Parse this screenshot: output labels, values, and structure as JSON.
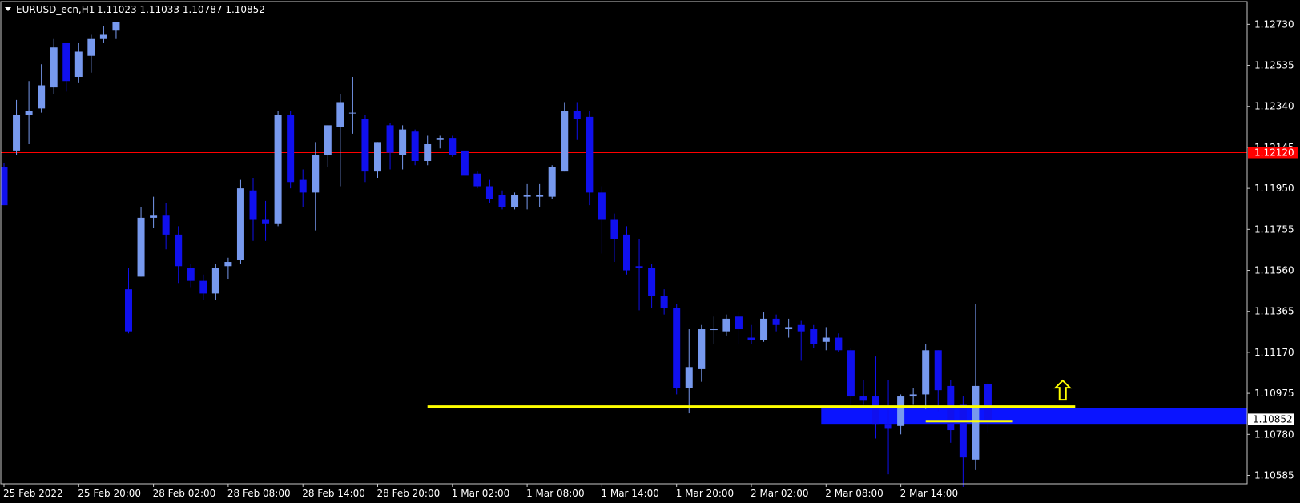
{
  "chart_data": {
    "type": "candlestick",
    "symbol_label": "EURUSD_ecn,H1",
    "ohlc_label": "1.11023 1.11033 1.10787 1.10852",
    "y_ticks": [
      "1.12730",
      "1.12535",
      "1.12340",
      "1.12145",
      "1.11950",
      "1.11755",
      "1.11560",
      "1.11365",
      "1.11170",
      "1.10975",
      "1.10780",
      "1.10585"
    ],
    "y_tick_values": [
      1.1273,
      1.12535,
      1.1234,
      1.12145,
      1.1195,
      1.11755,
      1.1156,
      1.11365,
      1.1117,
      1.10975,
      1.1078,
      1.10585
    ],
    "x_ticks": [
      "25 Feb 2022",
      "25 Feb 20:00",
      "28 Feb 02:00",
      "28 Feb 08:00",
      "28 Feb 14:00",
      "28 Feb 20:00",
      "1 Mar 02:00",
      "1 Mar 08:00",
      "1 Mar 14:00",
      "1 Mar 20:00",
      "2 Mar 02:00",
      "2 Mar 08:00",
      "2 Mar 14:00"
    ],
    "x_tick_bar_index": [
      0,
      6,
      12,
      18,
      24,
      30,
      36,
      42,
      48,
      54,
      60,
      66,
      72
    ],
    "ylim": [
      1.10545,
      1.12838
    ],
    "horizontal_line": {
      "price": 1.1212,
      "label": "1.12120",
      "color": "#ff0000"
    },
    "current_price": {
      "price": 1.10852,
      "label": "1.10852"
    },
    "zone": {
      "low": 1.1083,
      "high": 1.10905,
      "from_bar": 66,
      "color": "#0a14ff"
    },
    "yellow_lines": [
      {
        "price": 1.10912,
        "from_bar": 34,
        "to_bar": 86
      },
      {
        "price": 1.10843,
        "from_bar": 74,
        "to_bar": 81
      }
    ],
    "arrow": {
      "bar": 85,
      "price": 1.1099,
      "direction": "up",
      "color": "#ffff00"
    },
    "up_color": "#7799ee",
    "down_color": "#1010ee",
    "candles": [
      [
        1.1205,
        1.1207,
        1.1187,
        1.1187
      ],
      [
        1.1213,
        1.1237,
        1.1211,
        1.123
      ],
      [
        1.123,
        1.1246,
        1.1216,
        1.1232
      ],
      [
        1.1233,
        1.1254,
        1.1231,
        1.1244
      ],
      [
        1.1243,
        1.1266,
        1.124,
        1.1262
      ],
      [
        1.1264,
        1.1264,
        1.1241,
        1.1246
      ],
      [
        1.1248,
        1.1264,
        1.1245,
        1.126
      ],
      [
        1.1258,
        1.1268,
        1.125,
        1.1266
      ],
      [
        1.1266,
        1.1272,
        1.1264,
        1.1268
      ],
      [
        1.127,
        1.1274,
        1.1266,
        1.1274
      ],
      [
        1.1147,
        1.1157,
        1.1126,
        1.1127
      ],
      [
        1.1153,
        1.1186,
        1.1153,
        1.1181
      ],
      [
        1.1181,
        1.1191,
        1.1176,
        1.1182
      ],
      [
        1.1182,
        1.1188,
        1.1166,
        1.1173
      ],
      [
        1.1173,
        1.1177,
        1.115,
        1.1158
      ],
      [
        1.1157,
        1.1159,
        1.1148,
        1.1151
      ],
      [
        1.1151,
        1.1154,
        1.1142,
        1.1145
      ],
      [
        1.1145,
        1.1159,
        1.1142,
        1.1157
      ],
      [
        1.1158,
        1.1162,
        1.1152,
        1.116
      ],
      [
        1.1161,
        1.1199,
        1.1159,
        1.1195
      ],
      [
        1.1194,
        1.12,
        1.117,
        1.118
      ],
      [
        1.118,
        1.1189,
        1.117,
        1.1178
      ],
      [
        1.1178,
        1.1232,
        1.1177,
        1.123
      ],
      [
        1.123,
        1.1232,
        1.1195,
        1.1198
      ],
      [
        1.1199,
        1.1204,
        1.1186,
        1.1193
      ],
      [
        1.1193,
        1.1217,
        1.1175,
        1.1211
      ],
      [
        1.1211,
        1.1225,
        1.1205,
        1.1225
      ],
      [
        1.1224,
        1.124,
        1.1196,
        1.1236
      ],
      [
        1.1231,
        1.1248,
        1.1221,
        1.1231
      ],
      [
        1.1228,
        1.123,
        1.1198,
        1.1203
      ],
      [
        1.1203,
        1.1217,
        1.12,
        1.1217
      ],
      [
        1.1225,
        1.1226,
        1.1204,
        1.1212
      ],
      [
        1.1211,
        1.1225,
        1.1204,
        1.1223
      ],
      [
        1.1222,
        1.1223,
        1.1206,
        1.1208
      ],
      [
        1.1208,
        1.122,
        1.1206,
        1.1216
      ],
      [
        1.1218,
        1.122,
        1.1214,
        1.1219
      ],
      [
        1.1219,
        1.122,
        1.121,
        1.1211
      ],
      [
        1.1213,
        1.1213,
        1.1201,
        1.1201
      ],
      [
        1.1202,
        1.1203,
        1.1195,
        1.1196
      ],
      [
        1.1196,
        1.1199,
        1.1188,
        1.119
      ],
      [
        1.1192,
        1.1194,
        1.1185,
        1.1186
      ],
      [
        1.1186,
        1.1193,
        1.1185,
        1.1192
      ],
      [
        1.1191,
        1.1197,
        1.1185,
        1.1192
      ],
      [
        1.1191,
        1.1197,
        1.1186,
        1.1192
      ],
      [
        1.1191,
        1.1206,
        1.119,
        1.1205
      ],
      [
        1.1203,
        1.1236,
        1.1203,
        1.1232
      ],
      [
        1.1232,
        1.1236,
        1.1218,
        1.1228
      ],
      [
        1.1229,
        1.1232,
        1.1187,
        1.1193
      ],
      [
        1.1193,
        1.1196,
        1.1164,
        1.118
      ],
      [
        1.118,
        1.1183,
        1.116,
        1.1171
      ],
      [
        1.1173,
        1.1177,
        1.1154,
        1.1156
      ],
      [
        1.1158,
        1.1171,
        1.1137,
        1.1157
      ],
      [
        1.1157,
        1.1159,
        1.1138,
        1.1144
      ],
      [
        1.1144,
        1.1147,
        1.1135,
        1.1138
      ],
      [
        1.1138,
        1.114,
        1.1097,
        1.11
      ],
      [
        1.11,
        1.1128,
        1.1088,
        1.111
      ],
      [
        1.1109,
        1.113,
        1.1103,
        1.1128
      ],
      [
        1.1128,
        1.1134,
        1.1121,
        1.1128
      ],
      [
        1.1127,
        1.1135,
        1.1125,
        1.1133
      ],
      [
        1.1134,
        1.1136,
        1.1121,
        1.1128
      ],
      [
        1.1124,
        1.113,
        1.1121,
        1.1123
      ],
      [
        1.1123,
        1.1136,
        1.1122,
        1.1133
      ],
      [
        1.1133,
        1.1135,
        1.1127,
        1.113
      ],
      [
        1.1128,
        1.1133,
        1.1124,
        1.1129
      ],
      [
        1.113,
        1.1132,
        1.1113,
        1.1127
      ],
      [
        1.1128,
        1.113,
        1.1119,
        1.1121
      ],
      [
        1.1122,
        1.1129,
        1.1118,
        1.1124
      ],
      [
        1.1124,
        1.1126,
        1.1117,
        1.1118
      ],
      [
        1.1118,
        1.1119,
        1.1092,
        1.1096
      ],
      [
        1.1096,
        1.1104,
        1.1092,
        1.1094
      ],
      [
        1.1096,
        1.1115,
        1.1076,
        1.1083
      ],
      [
        1.1083,
        1.1104,
        1.1059,
        1.1081
      ],
      [
        1.1082,
        1.1097,
        1.1078,
        1.1096
      ],
      [
        1.1096,
        1.11,
        1.1092,
        1.1097
      ],
      [
        1.1097,
        1.1121,
        1.109,
        1.1118
      ],
      [
        1.1118,
        1.1118,
        1.1089,
        1.1099
      ],
      [
        1.1101,
        1.1104,
        1.1074,
        1.108
      ],
      [
        1.1092,
        1.1096,
        1.1053,
        1.1067
      ],
      [
        1.1066,
        1.114,
        1.1061,
        1.1101
      ],
      [
        1.1102,
        1.1103,
        1.1079,
        1.1085
      ]
    ]
  }
}
